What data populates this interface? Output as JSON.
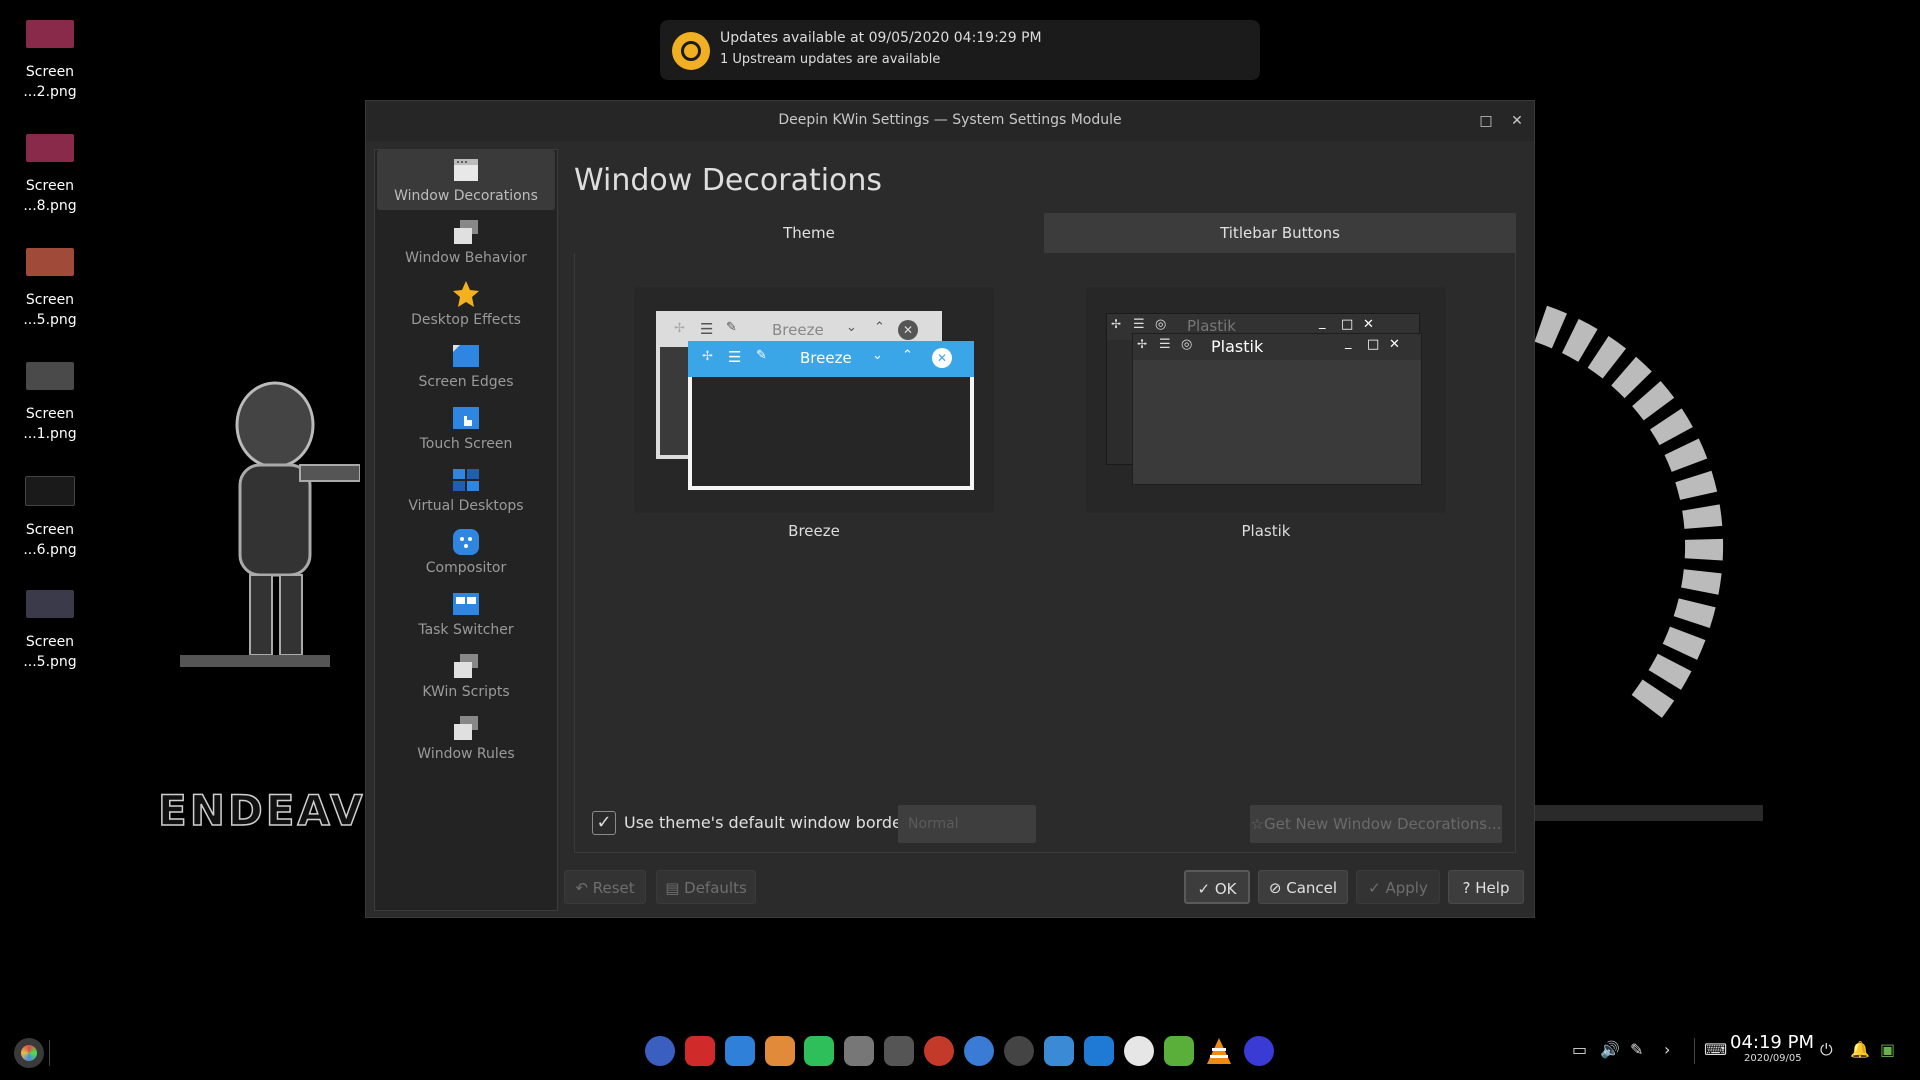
{
  "desktop": {
    "icons": [
      {
        "name": "Screen",
        "sub": "...2.png",
        "color": "#b0305a"
      },
      {
        "name": "Screen",
        "sub": "...8.png",
        "color": "#b0305a"
      },
      {
        "name": "Screen",
        "sub": "...5.png",
        "color": "#c06030"
      },
      {
        "name": "Screen",
        "sub": "...1.png",
        "color": "#5a5a5a"
      },
      {
        "name": "Screen",
        "sub": "...6.png",
        "color": "#333333"
      },
      {
        "name": "Screen",
        "sub": "...5.png",
        "color": "#4a4a5a"
      }
    ],
    "art_text": "ENDEAVO"
  },
  "notification": {
    "line1": "Updates available at 09/05/2020 04:19:29 PM",
    "line2": "1 Upstream updates are available"
  },
  "window": {
    "title": "Deepin KWin Settings — System Settings Module",
    "maximize_icon": "□",
    "close_icon": "✕"
  },
  "sidebar": {
    "items": [
      {
        "label": "Window Decorations",
        "icon": "window-icon"
      },
      {
        "label": "Window Behavior",
        "icon": "windows-stack-icon"
      },
      {
        "label": "Desktop Effects",
        "icon": "star-icon"
      },
      {
        "label": "Screen Edges",
        "icon": "screen-edges-icon"
      },
      {
        "label": "Touch Screen",
        "icon": "touch-icon"
      },
      {
        "label": "Virtual Desktops",
        "icon": "virtual-desktops-icon"
      },
      {
        "label": "Compositor",
        "icon": "compositor-icon"
      },
      {
        "label": "Task Switcher",
        "icon": "task-switcher-icon"
      },
      {
        "label": "KWin Scripts",
        "icon": "scripts-icon"
      },
      {
        "label": "Window Rules",
        "icon": "rules-icon"
      }
    ]
  },
  "main": {
    "title": "Window Decorations",
    "tabs": {
      "theme": "Theme",
      "titlebar": "Titlebar Buttons"
    },
    "previews": {
      "breeze": {
        "label": "Breeze",
        "window_title": "Breeze"
      },
      "plastik": {
        "label": "Plastik",
        "window_title": "Plastik"
      }
    },
    "use_default_border": {
      "label": "Use theme's default window borde...",
      "checked": "✓"
    },
    "border_combo": "Normal",
    "get_new": "☆Get New Window Decorations..."
  },
  "buttons": {
    "reset": "Reset",
    "defaults": "Defaults",
    "ok": "OK",
    "cancel": "Cancel",
    "apply": "Apply",
    "help": "Help"
  },
  "taskbar": {
    "time": "04:19 PM",
    "date": "2020/09/05",
    "dock_icons": [
      {
        "name": "settings-icon",
        "color": "#3b5fc0"
      },
      {
        "name": "terminal-icon",
        "color": "#d02a2a"
      },
      {
        "name": "store-icon",
        "color": "#2f80d8"
      },
      {
        "name": "photos-icon",
        "color": "#e08a3a"
      },
      {
        "name": "music-icon",
        "color": "#2fbf5a"
      },
      {
        "name": "game-icon",
        "color": "#777777"
      },
      {
        "name": "inkscape-icon",
        "color": "#555555"
      },
      {
        "name": "app-red-icon",
        "color": "#c43a2a"
      },
      {
        "name": "chromium-icon",
        "color": "#3a7bd5"
      },
      {
        "name": "steam-icon",
        "color": "#444444"
      },
      {
        "name": "desktop-icon",
        "color": "#3a8ad5"
      },
      {
        "name": "trello-icon",
        "color": "#1f7ad5"
      },
      {
        "name": "paint-icon",
        "color": "#e6e6e6"
      },
      {
        "name": "leaf-icon",
        "color": "#5aaf3a"
      },
      {
        "name": "vlc-icon",
        "color": "#f08a10"
      },
      {
        "name": "monitor-icon",
        "color": "#3a3ad5"
      }
    ]
  }
}
